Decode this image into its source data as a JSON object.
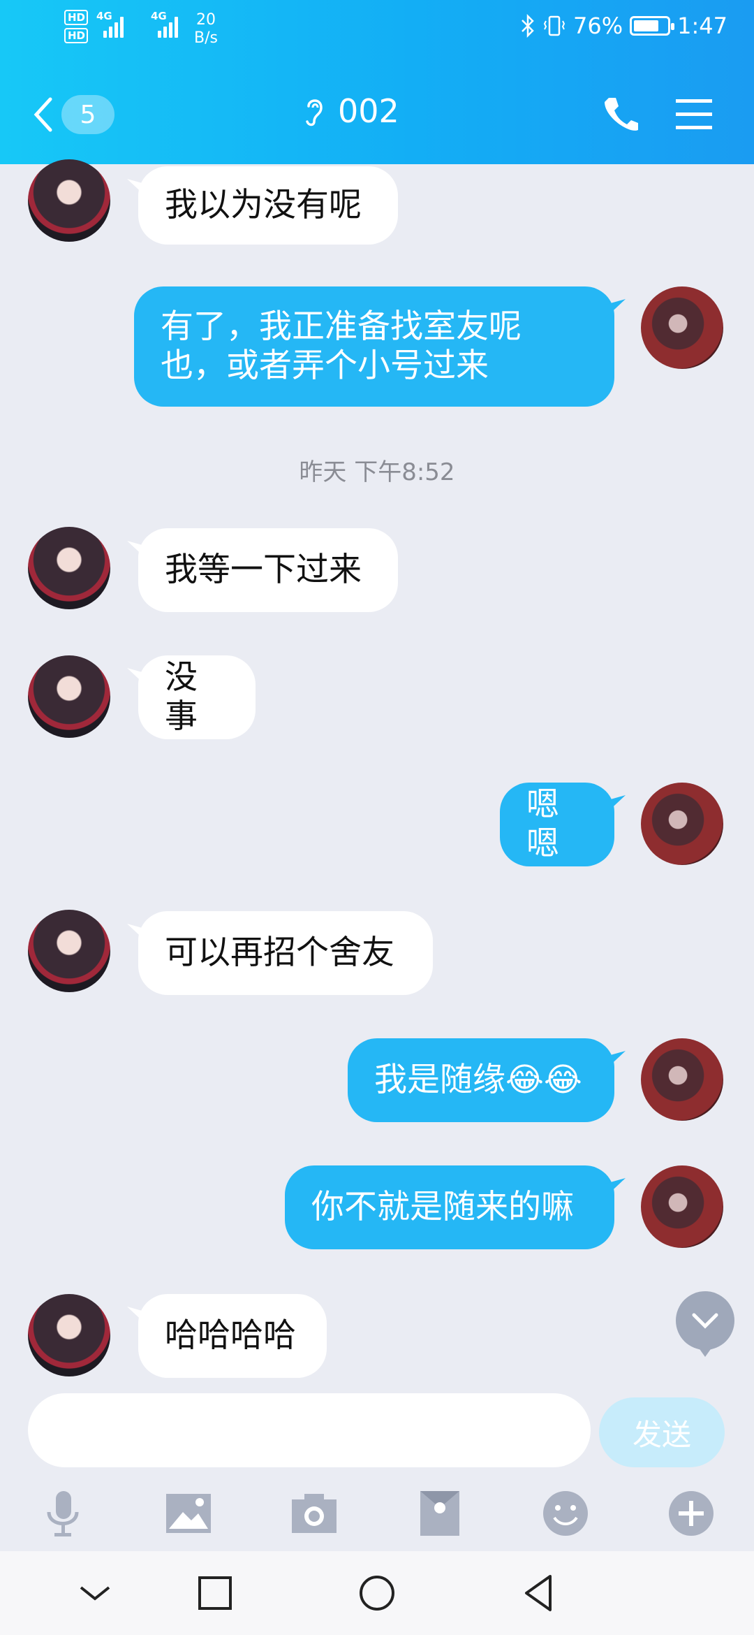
{
  "status_bar": {
    "hd1": "HD",
    "hd2": "HD",
    "net1": "4G",
    "net2": "4G",
    "speed_value": "20",
    "speed_unit": "B/s",
    "battery": "76%",
    "time": "1:47",
    "battery_level": 0.76
  },
  "header": {
    "unread_count": "5",
    "title": "002",
    "icons": [
      "back-chevron-icon",
      "ear-icon",
      "phone-icon",
      "menu-icon"
    ]
  },
  "messages": [
    {
      "side": "in",
      "text": "我以为没有呢"
    },
    {
      "side": "out",
      "line1": "有了，我正准备找室友呢",
      "line2": "也，或者弄个小号过来"
    },
    {
      "side": "in",
      "text": "我等一下过来"
    },
    {
      "side": "in",
      "text": "没事"
    },
    {
      "side": "out",
      "text": "嗯嗯"
    },
    {
      "side": "in",
      "text": "可以再招个舍友"
    },
    {
      "side": "out",
      "text": "我是随缘😂😂"
    },
    {
      "side": "out",
      "text": "你不就是随来的嘛"
    },
    {
      "side": "in",
      "text": "哈哈哈哈"
    }
  ],
  "timestamp": "昨天 下午8:52",
  "composer": {
    "input_value": "",
    "send_label": "发送",
    "tools": [
      "microphone-icon",
      "image-icon",
      "camera-icon",
      "red-envelope-icon",
      "emoji-icon",
      "plus-icon"
    ]
  },
  "colors": {
    "header_start": "#17c8f7",
    "header_end": "#1a9cf2",
    "outgoing_bubble": "#25b7f5",
    "incoming_bubble": "#ffffff",
    "background": "#eaecf3"
  }
}
